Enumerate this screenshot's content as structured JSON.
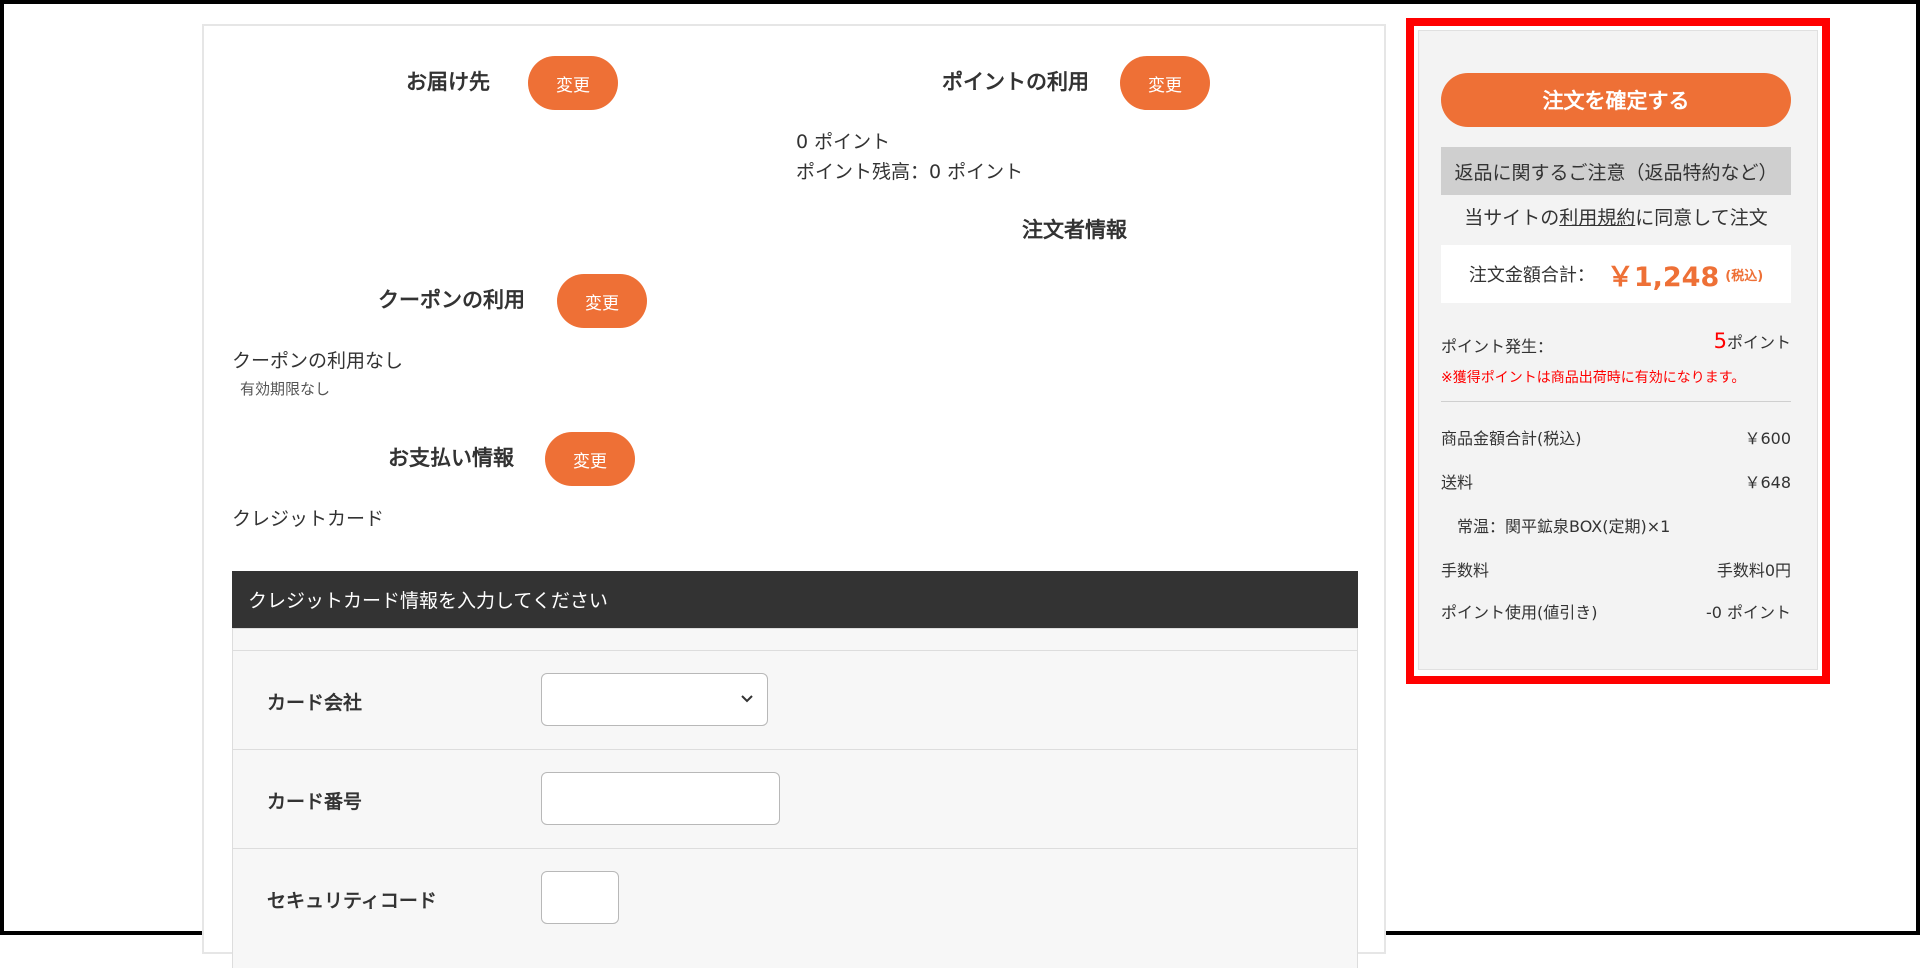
{
  "delivery": {
    "title": "お届け先",
    "change_label": "変更"
  },
  "points": {
    "title": "ポイントの利用",
    "change_label": "変更",
    "used": "0 ポイント",
    "balance": "ポイント残高：0 ポイント"
  },
  "orderer": {
    "title": "注文者情報"
  },
  "coupon": {
    "title": "クーポンの利用",
    "change_label": "変更",
    "status": "クーポンの利用なし",
    "expiry": "有効期限なし"
  },
  "payment": {
    "title": "お支払い情報",
    "change_label": "変更",
    "method": "クレジットカード"
  },
  "card_form": {
    "header": "クレジットカード情報を入力してください",
    "company_label": "カード会社",
    "company_value": "",
    "number_label": "カード番号",
    "number_value": "",
    "security_label": "セキュリティコード",
    "security_value": ""
  },
  "summary": {
    "confirm_label": "注文を確定する",
    "returns_notice": "返品に関するご注意（返品特約など）",
    "agree_prefix": "当サイトの",
    "agree_link": "利用規約",
    "agree_suffix": "に同意して注文",
    "total_label": "注文金額合計：",
    "total_amount": "￥1,248",
    "total_tax": "(税込)",
    "points_earned_label": "ポイント発生：",
    "points_earned_value": "5",
    "points_earned_unit": "ポイント",
    "points_notice": "※獲得ポイントは商品出荷時に有効になります。",
    "subtotal_label": "商品金額合計(税込)",
    "subtotal_value": "￥600",
    "shipping_label": "送料",
    "shipping_value": "￥648",
    "shipping_detail": "常温：関平鉱泉BOX(定期)×1",
    "fee_label": "手数料",
    "fee_value": "手数料0円",
    "points_used_label": "ポイント使用(値引き)",
    "points_used_value": "-0 ポイント"
  },
  "colors": {
    "accent": "#ee7036",
    "dark_header": "#333333",
    "highlight_frame": "#ff0000",
    "notice_red": "#ff0000"
  }
}
